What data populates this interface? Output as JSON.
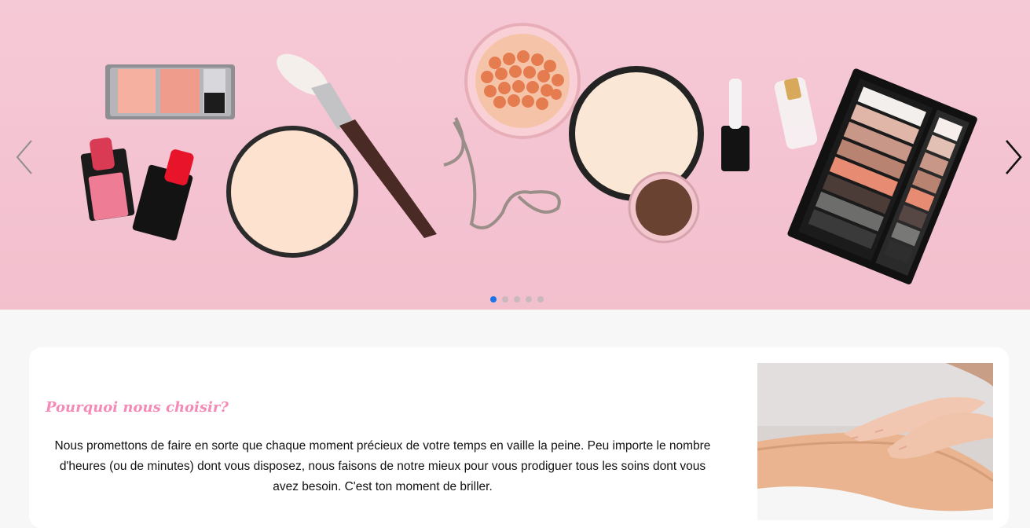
{
  "hero": {
    "prev_label": "Previous slide",
    "next_label": "Next slide",
    "slides_count": 5,
    "active_slide": 1,
    "accent_color": "#1a73e8"
  },
  "why_us": {
    "title": "Pourquoi nous choisir?",
    "paragraph": "Nous promettons de faire en sorte que chaque moment précieux de votre temps en vaille la peine. Peu importe le nombre d'heures (ou de minutes) dont vous disposez, nous faisons de notre mieux pour vous prodiguer tous les soins dont vous avez besoin. C'est ton moment de briller.",
    "title_color": "#f58ab6"
  },
  "icons": [
    "chevron-left-icon",
    "chevron-right-icon"
  ]
}
